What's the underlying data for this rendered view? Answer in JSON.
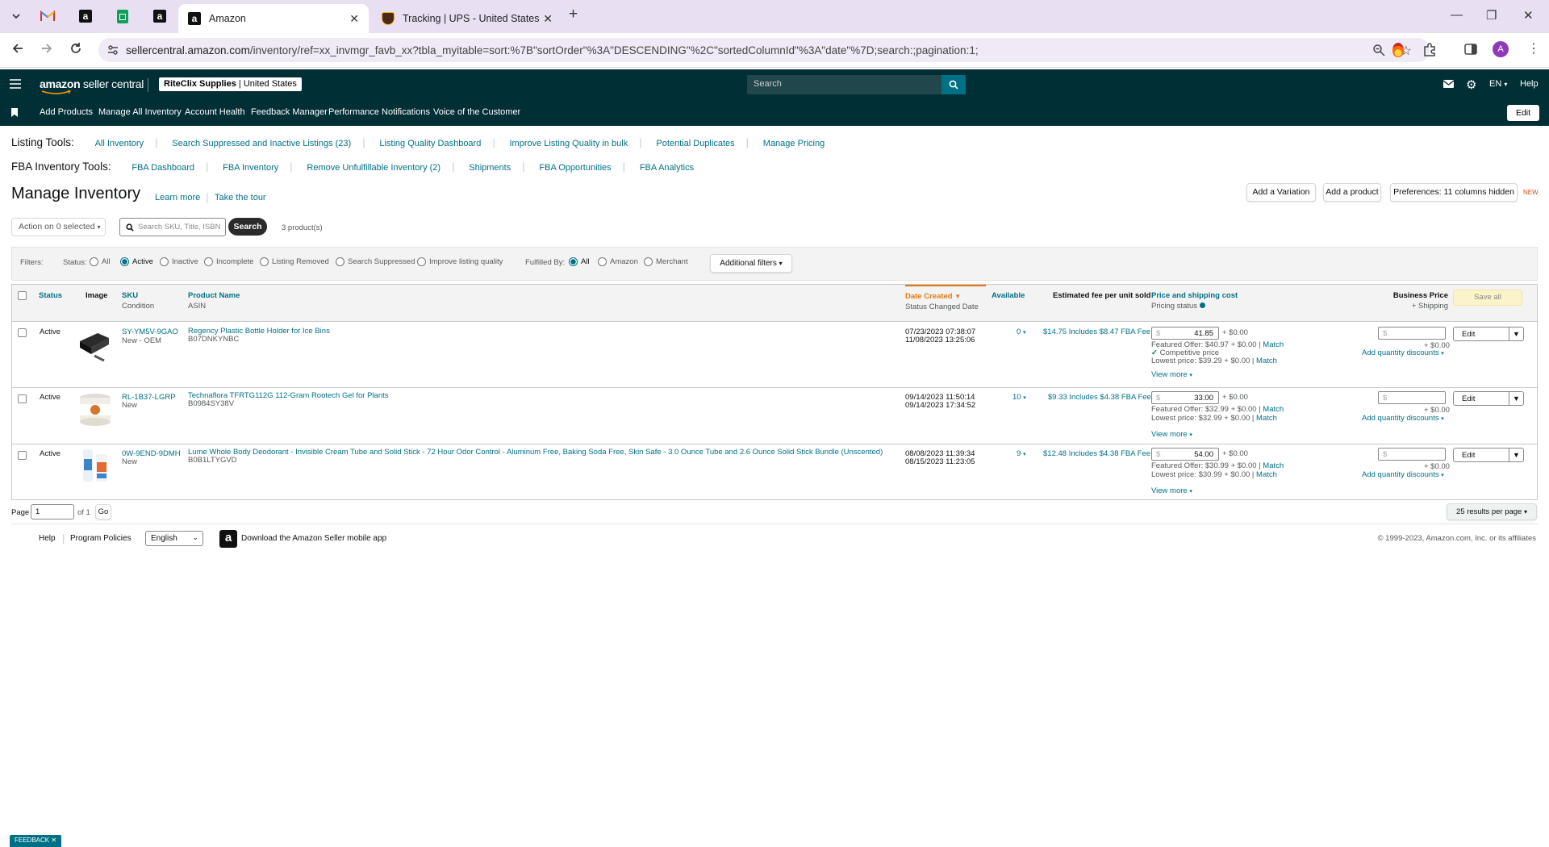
{
  "browser": {
    "tabs": [
      {
        "title": "Amazon",
        "active": true
      },
      {
        "title": "Tracking | UPS - United States",
        "active": false
      }
    ],
    "url_host": "sellercentral.amazon.com",
    "url_path": "/inventory/ref=xx_invmgr_favb_xx?tbla_myitable=sort:%7B\"sortOrder\"%3A\"DESCENDING\"%2C\"sortedColumnId\"%3A\"date\"%7D;search:;pagination:1;",
    "profile_initial": "A"
  },
  "header": {
    "logo": "amazon",
    "logo_suffix": "seller central",
    "store_name": "RiteClix Supplies",
    "store_region": "United States",
    "search_placeholder": "Search",
    "lang": "EN",
    "help": "Help"
  },
  "nav": {
    "items": [
      "Add Products",
      "Manage All Inventory",
      "Account Health",
      "Feedback Manager",
      "Performance Notifications",
      "Voice of the Customer"
    ],
    "edit": "Edit"
  },
  "listing_tools": {
    "label": "Listing Tools:",
    "links": [
      "All Inventory",
      "Search Suppressed and Inactive Listings (23)",
      "Listing Quality Dashboard",
      "Improve Listing Quality in bulk",
      "Potential Duplicates",
      "Manage Pricing"
    ]
  },
  "fba_tools": {
    "label": "FBA Inventory Tools:",
    "links": [
      "FBA Dashboard",
      "FBA Inventory",
      "Remove Unfulfillable Inventory (2)",
      "Shipments",
      "FBA Opportunities",
      "FBA Analytics"
    ]
  },
  "page": {
    "title": "Manage Inventory",
    "learn_more": "Learn more",
    "tour": "Take the tour",
    "add_variation": "Add a Variation",
    "add_product": "Add a product",
    "preferences": "Preferences: 11 columns hidden",
    "new_badge": "NEW",
    "action": "Action on 0 selected",
    "search_placeholder": "Search SKU, Title, ISBN",
    "search_btn": "Search",
    "count": "3 product(s)"
  },
  "filters": {
    "label": "Filters:",
    "status_label": "Status:",
    "status_options": [
      "All",
      "Active",
      "Inactive",
      "Incomplete",
      "Listing Removed",
      "Search Suppressed",
      "Improve listing quality"
    ],
    "status_selected": "Active",
    "fulfilled_label": "Fulfilled By:",
    "fulfilled_options": [
      "All",
      "Amazon",
      "Merchant"
    ],
    "fulfilled_selected": "All",
    "additional": "Additional filters"
  },
  "table": {
    "headers": {
      "status": "Status",
      "image": "Image",
      "sku": "SKU",
      "sku_sub": "Condition",
      "product": "Product Name",
      "product_sub": "ASIN",
      "date": "Date Created",
      "date_sub": "Status Changed Date",
      "available": "Available",
      "fee": "Estimated fee per unit sold",
      "price": "Price and shipping cost",
      "price_sub": "Pricing status",
      "business": "Business Price",
      "business_sub": "+ Shipping",
      "save_all": "Save all"
    },
    "rows": [
      {
        "status": "Active",
        "sku": "SY-YM5V-9GAO",
        "condition": "New - OEM",
        "name": "Regency Plastic Bottle Holder for Ice Bins",
        "asin": "B07DNKYNBC",
        "created": "07/23/2023 07:38:07",
        "changed": "11/08/2023 13:25:06",
        "available": "0",
        "fee": "$14.75 Includes $8.47 FBA Fee",
        "price": "41.85",
        "ship": "+ $0.00",
        "featured": "Featured Offer: $40.97 + $0.00",
        "competitive": "Competitive price",
        "lowest": "Lowest price: $39.29 + $0.00",
        "match": "Match",
        "view_more": "View more",
        "biz_ship": "+ $0.00",
        "qty_disc": "Add quantity discounts",
        "edit": "Edit"
      },
      {
        "status": "Active",
        "sku": "RL-1B37-LGRP",
        "condition": "New",
        "name": "Technaflora TFRTG112G 112-Gram Rootech Gel for Plants",
        "asin": "B0984SY38V",
        "created": "09/14/2023 11:50:14",
        "changed": "09/14/2023 17:34:52",
        "available": "10",
        "fee": "$9.33 Includes $4.38 FBA Fee",
        "price": "33.00",
        "ship": "+ $0.00",
        "featured": "Featured Offer: $32.99 + $0.00",
        "competitive": "",
        "lowest": "Lowest price: $32.99 + $0.00",
        "match": "Match",
        "view_more": "View more",
        "biz_ship": "+ $0.00",
        "qty_disc": "Add quantity discounts",
        "edit": "Edit"
      },
      {
        "status": "Active",
        "sku": "0W-9END-9DMH",
        "condition": "New",
        "name": "Lume Whole Body Deodorant - Invisible Cream Tube and Solid Stick - 72 Hour Odor Control - Aluminum Free, Baking Soda Free, Skin Safe - 3.0 Ounce Tube and 2.6 Ounce Solid Stick Bundle (Unscented)",
        "asin": "B0B1LTYGVD",
        "created": "08/08/2023 11:39:34",
        "changed": "08/15/2023 11:23:05",
        "available": "9",
        "fee": "$12.48 Includes $4.38 FBA Fee",
        "price": "54.00",
        "ship": "+ $0.00",
        "featured": "Featured Offer: $30.99 + $0.00",
        "competitive": "",
        "lowest": "Lowest price: $30.99 + $0.00",
        "match": "Match",
        "view_more": "View more",
        "biz_ship": "+ $0.00",
        "qty_disc": "Add quantity discounts",
        "edit": "Edit"
      }
    ]
  },
  "pagination": {
    "page_label": "Page",
    "page_value": "1",
    "of": "of 1",
    "go": "Go",
    "per_page": "25 results per page"
  },
  "footer": {
    "help": "Help",
    "policies": "Program Policies",
    "language": "English",
    "app": "Download the Amazon Seller mobile app",
    "copyright": "© 1999-2023, Amazon.com, Inc. or its affiliates"
  },
  "feedback": "FEEDBACK"
}
